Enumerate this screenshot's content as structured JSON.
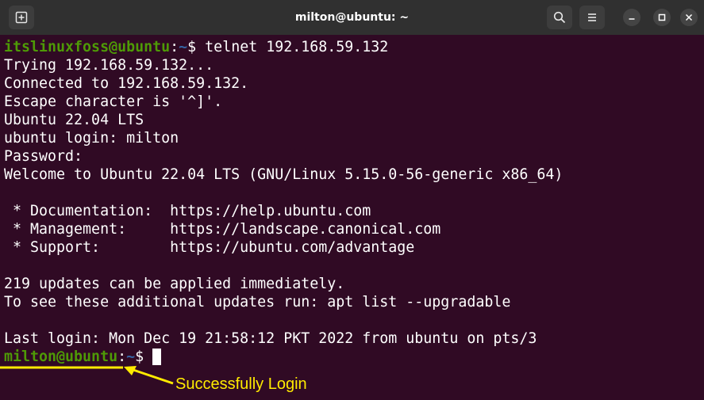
{
  "window": {
    "title": "milton@ubuntu: ~",
    "new_tab_icon": "new-tab-icon",
    "search_icon": "search-icon",
    "menu_icon": "hamburger-menu-icon",
    "minimize_icon": "minimize-icon",
    "maximize_icon": "maximize-icon",
    "close_icon": "close-icon"
  },
  "terminal": {
    "prompt1": {
      "user_host": "itslinuxfoss@ubuntu",
      "colon": ":",
      "path": "~",
      "dollar": "$",
      "command": " telnet 192.168.59.132"
    },
    "lines": [
      "Trying 192.168.59.132...",
      "Connected to 192.168.59.132.",
      "Escape character is '^]'.",
      "Ubuntu 22.04 LTS",
      "ubuntu login: milton",
      "Password:",
      "Welcome to Ubuntu 22.04 LTS (GNU/Linux 5.15.0-56-generic x86_64)",
      "",
      " * Documentation:  https://help.ubuntu.com",
      " * Management:     https://landscape.canonical.com",
      " * Support:        https://ubuntu.com/advantage",
      "",
      "219 updates can be applied immediately.",
      "To see these additional updates run: apt list --upgradable",
      "",
      "Last login: Mon Dec 19 21:58:12 PKT 2022 from ubuntu on pts/3"
    ],
    "prompt2": {
      "user_host": "milton@ubuntu",
      "colon": ":",
      "path": "~",
      "dollar": "$ "
    }
  },
  "annotation": {
    "label": "Successfully Login",
    "color": "#ffeb00"
  },
  "colors": {
    "background": "#300a24",
    "titlebar": "#303030",
    "prompt_user": "#4e9a06",
    "prompt_path": "#3465a4"
  }
}
